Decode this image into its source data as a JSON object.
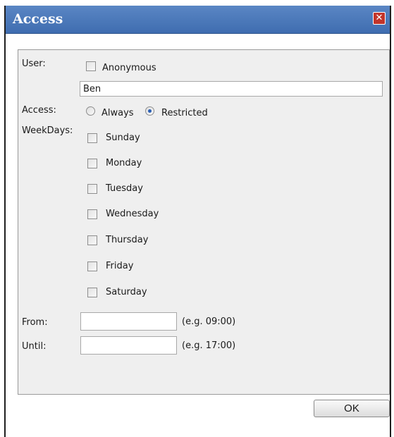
{
  "window": {
    "title": "Access",
    "close_glyph": "✕"
  },
  "form": {
    "user_label": "User:",
    "anonymous_label": "Anonymous",
    "anonymous_checked": false,
    "user_value": "Ben",
    "access_label": "Access:",
    "access_options": [
      {
        "label": "Always",
        "selected": false
      },
      {
        "label": "Restricted",
        "selected": true
      }
    ],
    "weekdays_label": "WeekDays:",
    "weekdays": [
      {
        "label": "Sunday",
        "checked": false
      },
      {
        "label": "Monday",
        "checked": false
      },
      {
        "label": "Tuesday",
        "checked": false
      },
      {
        "label": "Wednesday",
        "checked": false
      },
      {
        "label": "Thursday",
        "checked": false
      },
      {
        "label": "Friday",
        "checked": false
      },
      {
        "label": "Saturday",
        "checked": false
      }
    ],
    "from_label": "From:",
    "from_value": "",
    "from_hint": "(e.g. 09:00)",
    "until_label": "Until:",
    "until_value": "",
    "until_hint": "(e.g. 17:00)"
  },
  "buttons": {
    "ok_label": "OK"
  },
  "colors": {
    "titlebar": "#4a78ba",
    "panel": "#efefef",
    "radio_selected": "#2b5fb4"
  }
}
